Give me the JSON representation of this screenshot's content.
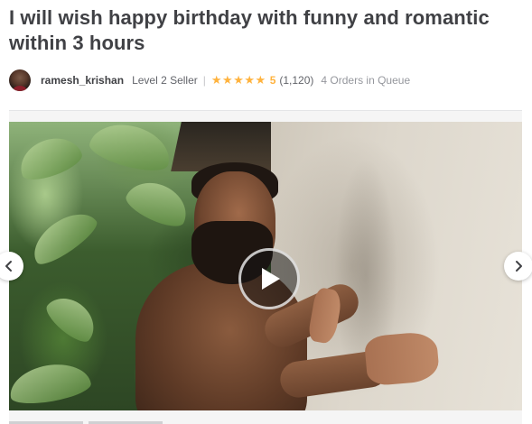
{
  "gig": {
    "title": "I will wish happy birthday with funny and romantic within 3 hours"
  },
  "seller": {
    "name": "ramesh_krishan",
    "level": "Level 2 Seller",
    "divider": "|",
    "stars": "★★★★★",
    "rating": "5",
    "reviews": "(1,120)",
    "queue": "4 Orders in Queue"
  },
  "gallery": {
    "media_type": "video",
    "icons": {
      "play": "play-icon",
      "prev": "chevron-left-icon",
      "next": "chevron-right-icon"
    }
  },
  "colors": {
    "title": "#404145",
    "star": "#ffb33e",
    "muted": "#95979d"
  }
}
